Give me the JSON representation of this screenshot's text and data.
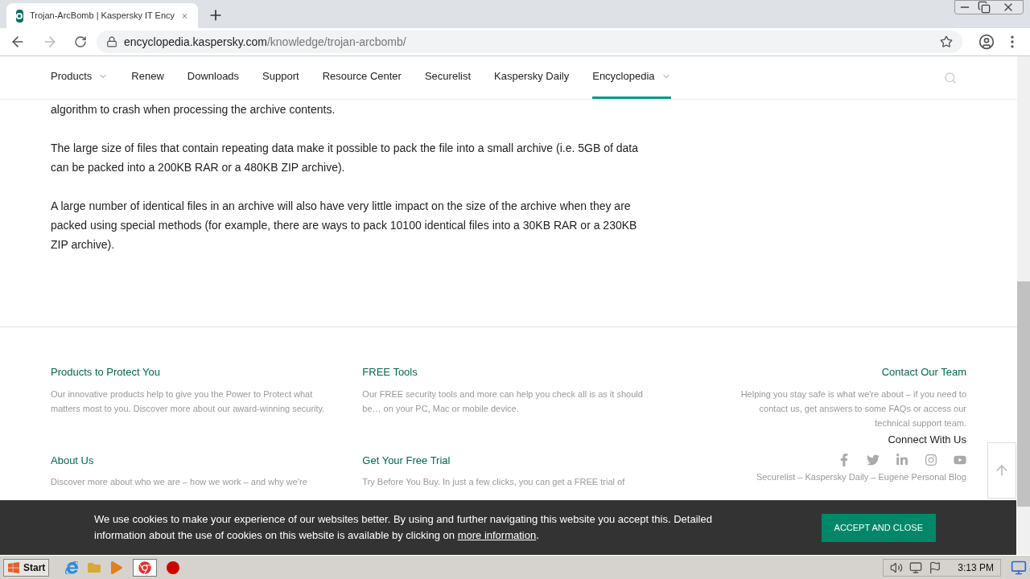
{
  "browser": {
    "tab_title": "Trojan-ArcBomb | Kaspersky IT Ency",
    "url_host": "encyclopedia.kaspersky.com",
    "url_path": "/knowledge/trojan-arcbomb/"
  },
  "nav": {
    "items": [
      {
        "label": "Products",
        "dropdown": true,
        "selected": false
      },
      {
        "label": "Renew",
        "dropdown": false,
        "selected": false
      },
      {
        "label": "Downloads",
        "dropdown": false,
        "selected": false
      },
      {
        "label": "Support",
        "dropdown": false,
        "selected": false
      },
      {
        "label": "Resource Center",
        "dropdown": false,
        "selected": false
      },
      {
        "label": "Securelist",
        "dropdown": false,
        "selected": false
      },
      {
        "label": "Kaspersky Daily",
        "dropdown": false,
        "selected": false
      },
      {
        "label": "Encyclopedia",
        "dropdown": true,
        "selected": true
      }
    ]
  },
  "article": {
    "paragraphs": [
      "algorithm to crash when processing the archive contents.",
      "The large size of files that contain repeating data make it possible to pack the file into a small archive (i.e. 5GB of data can be packed into a 200KB RAR or a 480KB ZIP archive).",
      "A large number of identical files in an archive will also have very little impact on the size of the archive when they are packed using special methods (for example, there are ways to pack 10100 identical files into a 30KB RAR or a 230KB ZIP archive)."
    ]
  },
  "footer": {
    "rows": [
      [
        {
          "title": "Products to Protect You",
          "text": "Our innovative products help to give you the Power to Protect what matters most to you. Discover more about our award-winning security."
        },
        {
          "title": "FREE Tools",
          "text": "Our FREE security tools and more can help you check all is as it should be… on your PC, Mac or mobile device."
        },
        {
          "title": "Contact Our Team",
          "text": "Helping you stay safe is what we're about – if you need to contact us, get answers to some FAQs or access our technical support team."
        }
      ],
      [
        {
          "title": "About Us",
          "text": "Discover more about who we are – how we work – and why we're"
        },
        {
          "title": "Get Your Free Trial",
          "text": "Try Before You Buy. In just a few clicks, you can get a FREE trial of"
        },
        {
          "title": "Connect With Us",
          "text": "Securelist – Kaspersky Daily – Eugene Personal Blog"
        }
      ]
    ]
  },
  "cookie": {
    "text": "We use cookies to make your experience of our websites better. By using and further navigating this website you accept this. Detailed information about the use of cookies on this website is available by clicking on",
    "link": "more information",
    "end": ".",
    "button": "ACCEPT AND CLOSE"
  },
  "taskbar": {
    "start": "Start",
    "clock": "3:13 PM"
  }
}
